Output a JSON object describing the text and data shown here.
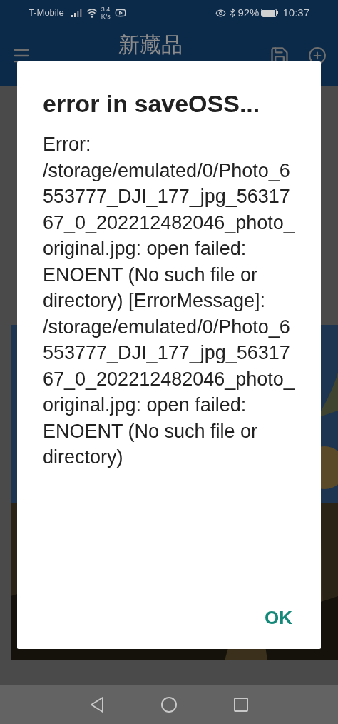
{
  "status_bar": {
    "carrier": "T-Mobile",
    "speed_value": "3.4",
    "speed_unit": "K/s",
    "battery": "92%",
    "time": "10:37"
  },
  "app_bar": {
    "title": "新藏品"
  },
  "dialog": {
    "title": "error in saveOSS...",
    "message": "Error: /storage/emulated/0/Photo_6553777_DJI_177_jpg_5631767_0_202212482046_photo_original.jpg: open failed: ENOENT (No such file or directory) [ErrorMessage]: /storage/emulated/0/Photo_6553777_DJI_177_jpg_5631767_0_202212482046_photo_original.jpg: open failed: ENOENT (No such file or directory)",
    "buttons": [
      "OK"
    ]
  }
}
